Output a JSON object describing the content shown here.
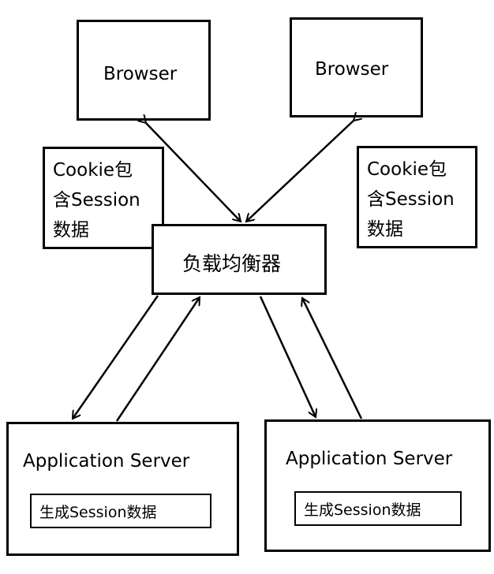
{
  "browsers": [
    {
      "label": "Browser"
    },
    {
      "label": "Browser"
    }
  ],
  "cookies": [
    {
      "lines": [
        "Cookie包",
        "含Session",
        "数据"
      ]
    },
    {
      "lines": [
        "Cookie包",
        "含Session",
        "数据"
      ]
    }
  ],
  "load_balancer": {
    "label": "负载均衡器"
  },
  "servers": [
    {
      "label": "Application Server",
      "inner": "生成Session数据"
    },
    {
      "label": "Application Server",
      "inner": "生成Session数据"
    }
  ]
}
